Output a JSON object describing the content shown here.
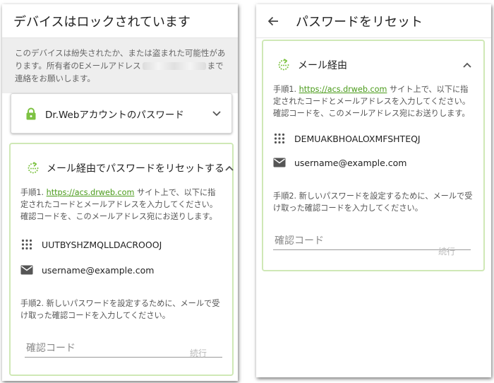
{
  "colors": {
    "accent_green": "#7dc242",
    "link_green": "#4a9b1a",
    "card_border_green": "#cfe8b6",
    "notice_bg": "#eeeeee",
    "icon_gray": "#555555",
    "disabled_text": "#b8b8b8"
  },
  "left_screen": {
    "appbar": {
      "title": "デバイスはロックされています"
    },
    "notice": {
      "text_before": "このデバイスは紛失されたか、または盗まれた可能性があります。所有者のEメールアドレス",
      "text_after": "まで連絡をお願いします。"
    },
    "account_card": {
      "icon": "lock-icon",
      "title": "Dr.Webアカウントのパスワード",
      "chevron": "chevron-down-icon"
    },
    "email_card": {
      "icon": "reset-icon",
      "title": "メール経由でパスワードをリセットする",
      "chevron": "chevron-up-icon",
      "step1_prefix": "手順1. ",
      "step1_link": "https://acs.drweb.com",
      "step1_suffix": " サイト上で、以下に指定されたコードとメールアドレスを入力してください。確認コードを、このメールアドレス宛にお送りします。",
      "code": "UUTBYSHZMQLLDACROOOJ",
      "email": "username@example.com",
      "step2": "手順2. 新しいパスワードを設定するために、メールで受け取った確認コードを入力してください。",
      "input_placeholder": "確認コード",
      "next_label": "続行"
    }
  },
  "right_screen": {
    "appbar": {
      "title": "パスワードをリセット",
      "back_icon": "arrow-left-icon"
    },
    "email_card": {
      "icon": "reset-icon",
      "title": "メール経由",
      "chevron": "chevron-up-icon",
      "step1_prefix": "手順1. ",
      "step1_link": "https://acs.drweb.com",
      "step1_suffix": " サイト上で、以下に指定されたコードとメールアドレスを入力してください。確認コードを、このメールアドレス宛にお送りします。",
      "code": "DEMUAKBHOALOXMFSHTEQJ",
      "email": "username@example.com",
      "step2": "手順2. 新しいパスワードを設定するために、メールで受け取った確認コードを入力してください。",
      "input_placeholder": "確認コード",
      "next_label": "続行"
    }
  }
}
